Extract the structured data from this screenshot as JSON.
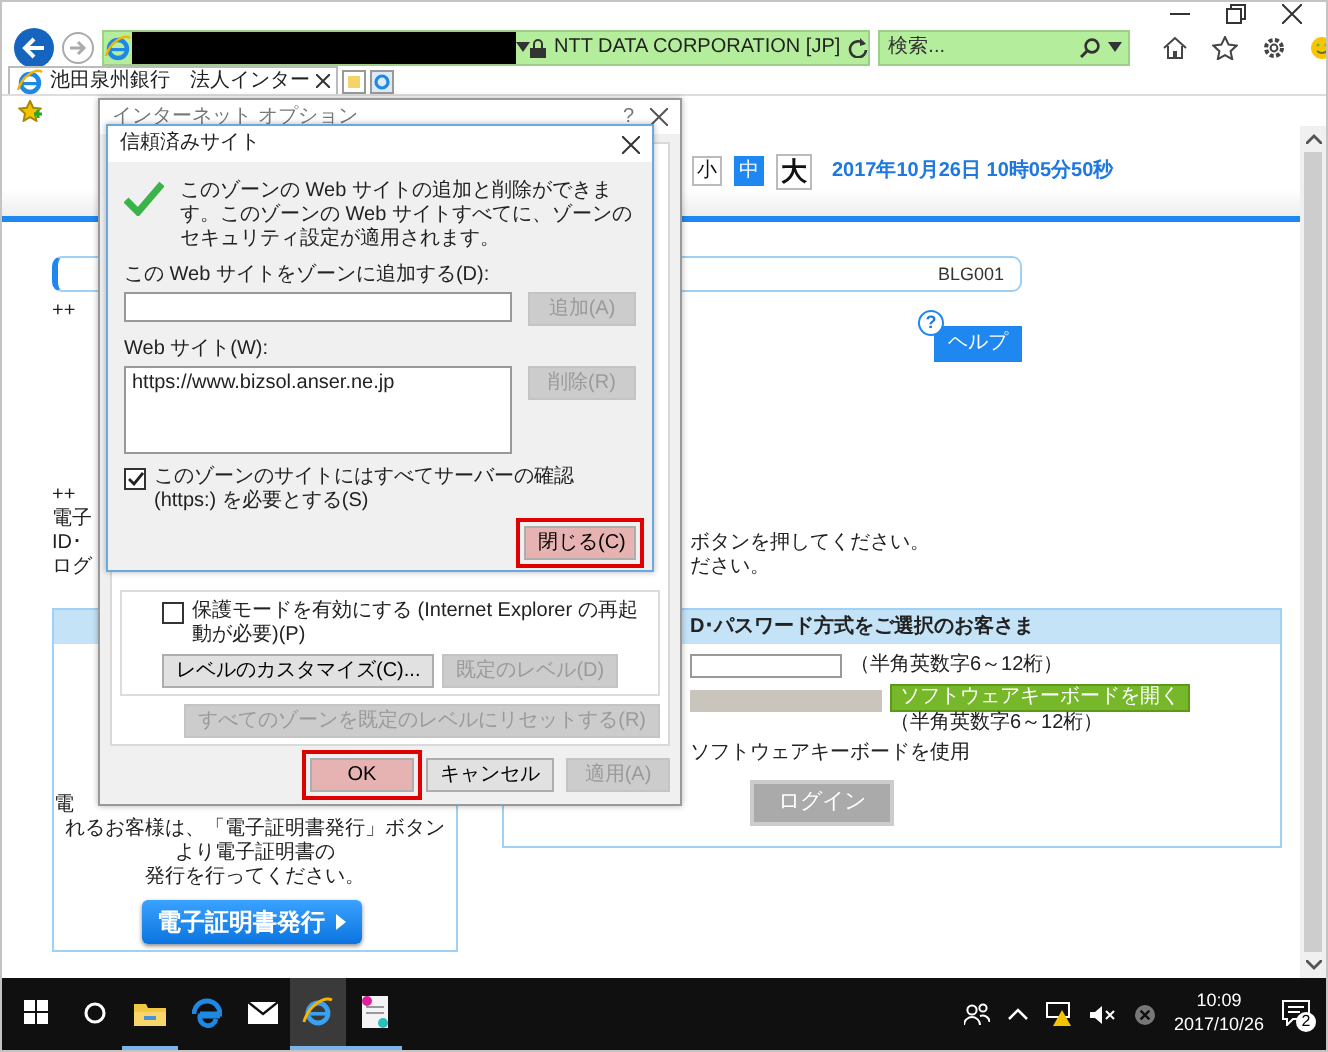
{
  "browser": {
    "address": {
      "identity": "NTT DATA CORPORATION [JP]"
    },
    "search": {
      "placeholder": "検索..."
    },
    "tabs": [
      {
        "label": "池田泉州銀行　法人インター",
        "selected": true
      }
    ]
  },
  "page": {
    "text_sizes": [
      {
        "label": "小",
        "selected": false
      },
      {
        "label": "中",
        "selected": true
      },
      {
        "label": "大",
        "selected": false
      }
    ],
    "datetime": "2017年10月26日 10時05分50秒",
    "screen_id": "BLG001",
    "help": {
      "badge": "?",
      "label": "ヘルプ"
    },
    "left_fragments": [
      "++",
      "++",
      "電子",
      "ID･",
      "ログ"
    ],
    "right_fragments": [
      "ボタンを押してください。",
      "ださい。"
    ],
    "certificate_box": {
      "fragment": "電",
      "lines": [
        "れるお客様は、「電子証明書発行」ボタンより電子証明書の",
        "発行を行ってください。"
      ],
      "button": "電子証明書発行"
    },
    "password_box": {
      "header": "D･パスワード方式をご選択のお客さま",
      "id_hint": "（半角英数字6～12桁）",
      "keyboard_button": "ソフトウェアキーボードを開く",
      "password_hint": "（半角英数字6～12桁）",
      "software_keyboard": "ソフトウェアキーボードを使用",
      "login": "ログイン"
    }
  },
  "options_dialog": {
    "title": "インターネット オプション",
    "help": "?",
    "protected_mode": {
      "label": "保護モードを有効にする (Internet Explorer の再起動が必要)(P)",
      "checked": false
    },
    "buttons": [
      {
        "label": "レベルのカスタマイズ(C)...",
        "disabled": false
      },
      {
        "label": "既定のレベル(D)",
        "disabled": true
      }
    ],
    "reset": {
      "label": "すべてのゾーンを既定のレベルにリセットする(R)",
      "disabled": true
    },
    "footer": [
      {
        "label": "OK",
        "disabled": false,
        "highlighted": true
      },
      {
        "label": "キャンセル",
        "disabled": false,
        "highlighted": false
      },
      {
        "label": "適用(A)",
        "disabled": true,
        "highlighted": false
      }
    ]
  },
  "trusted_sites_dialog": {
    "title": "信頼済みサイト",
    "message": "このゾーンの Web サイトの追加と削除ができます。このゾーンの Web サイトすべてに、ゾーンのセキュリティ設定が適用されます。",
    "add_label": "この Web サイトをゾーンに追加する(D):",
    "add_button": {
      "label": "追加(A)",
      "disabled": true
    },
    "sites_label": "Web サイト(W):",
    "sites": [
      "https://www.bizsol.anser.ne.jp"
    ],
    "remove_button": {
      "label": "削除(R)",
      "disabled": true
    },
    "require_https": {
      "label": "このゾーンのサイトにはすべてサーバーの確認 (https:) を必要とする(S)",
      "checked": true
    },
    "close_button": {
      "label": "閉じる(C)",
      "disabled": false,
      "highlighted": true
    }
  },
  "taskbar": {
    "apps": [
      {
        "kind": "explorer",
        "running": true,
        "selected": false
      },
      {
        "kind": "edge",
        "running": false,
        "selected": false
      },
      {
        "kind": "mail",
        "running": false,
        "selected": false
      },
      {
        "kind": "ie",
        "running": true,
        "selected": true
      },
      {
        "kind": "document",
        "running": true,
        "selected": false
      }
    ],
    "time": "10:09",
    "date": "2017/10/26",
    "notifications": "2"
  }
}
